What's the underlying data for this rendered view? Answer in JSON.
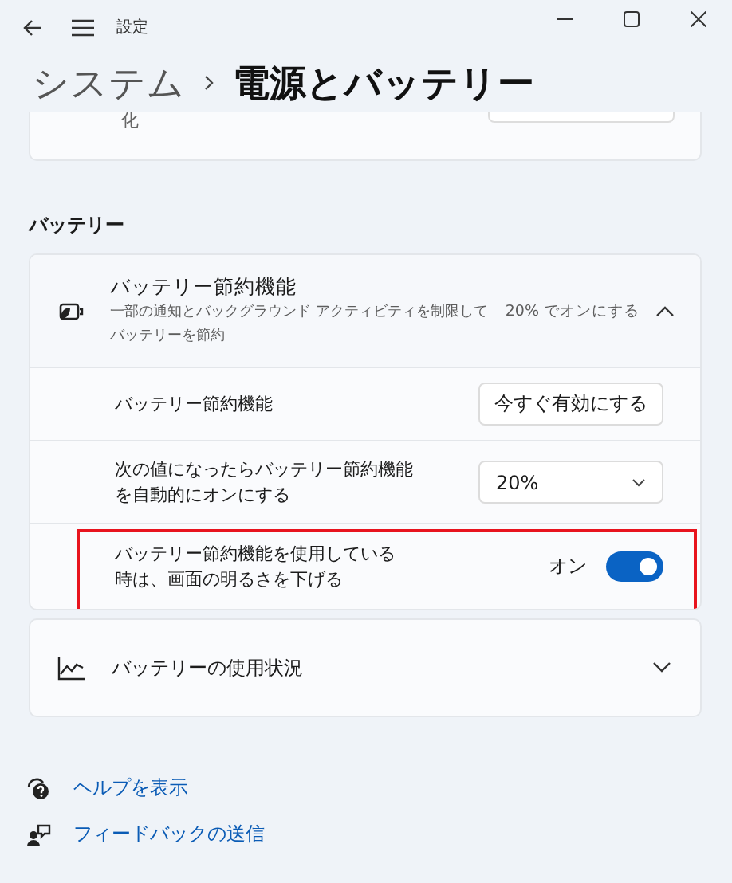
{
  "window": {
    "title": "設定"
  },
  "breadcrumb": {
    "parent": "システム",
    "current": "電源とバッテリー"
  },
  "partial_card": {
    "description_tail": "化"
  },
  "section": {
    "title": "バッテリー"
  },
  "battery_saver": {
    "title": "バッテリー節約機能",
    "description": "一部の通知とバックグラウンド アクティビティを制限してバッテリーを節約",
    "status": "20% でオンにする",
    "expanded": true,
    "settings": [
      {
        "kind": "button",
        "label": "バッテリー節約機能",
        "button": "今すぐ有効にする"
      },
      {
        "kind": "dropdown",
        "label": "次の値になったらバッテリー節約機能を自動的にオンにする",
        "value": "20%"
      },
      {
        "kind": "toggle",
        "label": "バッテリー節約機能を使用している時は、画面の明るさを下げる",
        "state_text": "オン",
        "on": true,
        "highlighted": true
      }
    ]
  },
  "usage": {
    "title": "バッテリーの使用状況",
    "expanded": false
  },
  "links": [
    {
      "kind": "help",
      "label": "ヘルプを表示"
    },
    {
      "kind": "feedback",
      "label": "フィードバックの送信"
    }
  ]
}
